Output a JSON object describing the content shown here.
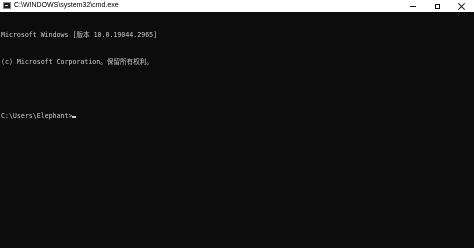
{
  "window": {
    "title": "C:\\WINDOWS\\system32\\cmd.exe",
    "icon": "cmd-icon",
    "controls": {
      "minimize_icon": "minimize-icon",
      "maximize_icon": "maximize-icon",
      "close_icon": "close-icon"
    }
  },
  "console": {
    "lines": [
      "Microsoft Windows [版本 10.0.19044.2965]",
      "(c) Microsoft Corporation。保留所有权利。",
      "",
      "C:\\Users\\Elephant>"
    ],
    "background": "#0c0c0c",
    "foreground": "#cccccc"
  }
}
